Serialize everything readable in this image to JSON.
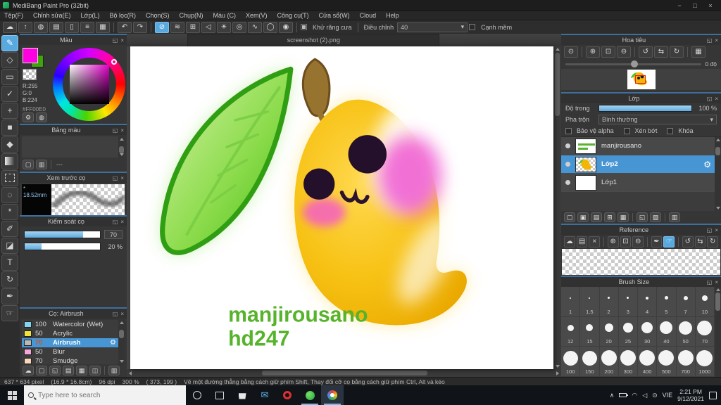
{
  "window": {
    "title": "MediBang Paint Pro (32bit)"
  },
  "icons": {
    "minimize": "−",
    "maximize": "□",
    "close": "×",
    "popout": "◱",
    "panel_close": "×",
    "cloud": "☁",
    "publish": "↑",
    "comment": "◍",
    "chat": "▤",
    "document": "▯",
    "config": "≡",
    "material": "▦",
    "undo": "↶",
    "redo": "↷",
    "snap_off": "⊘",
    "snap_parallel": "≋",
    "snap_cross": "⊞",
    "snap_vanish": "◁",
    "snap_radial": "☀",
    "snap_concentric": "◎",
    "snap_curve": "∿",
    "snap_ellipse": "◯",
    "snap_rings": "◉",
    "dropdown_arrow": "▾",
    "tool_brush": "✎",
    "tool_eraser": "◇",
    "tool_marquee": "▭",
    "tool_select_pen": "✓",
    "tool_move": "+",
    "tool_shape": "■",
    "tool_bucket": "◆",
    "tool_lasso": "◌",
    "tool_wand": "*",
    "tool_draft_pen": "✐",
    "tool_select_eraser": "◪",
    "tool_text": "T",
    "tool_transform": "↻",
    "tool_eraser2": "▱",
    "tool_eyedropper": "✒",
    "tool_hand": "☞",
    "new_item": "▢",
    "trash": "▥",
    "palette_color": "⚙",
    "palette_add": "◍",
    "zoom_actual": "⊙",
    "zoom_in": "⊕",
    "zoom_fit": "⊡",
    "zoom_out": "⊖",
    "rotate_left": "↺",
    "flip": "⇆",
    "rotate_right": "↻",
    "material_nav": "▦",
    "gear": "⚙",
    "layer_new": "▢",
    "layer_dup": "▣",
    "layer_conv": "▤",
    "layer_add_set": "⊞",
    "layer_folder": "▦",
    "layer_merge": "◱",
    "layer_special": "▧",
    "brush_cloud": "☁",
    "brush_new": "▢",
    "brush_new2": "◱",
    "brush_edit": "▤",
    "brush_folder": "▦",
    "brush_dup": "◫",
    "ref_folder": "▤",
    "ref_close": "×",
    "mail": "✉",
    "tray_chevron": "∧",
    "tray_wifi": "◠",
    "tray_speaker": "◁",
    "tray_pen": "⊙"
  },
  "menu": {
    "items": [
      "Tệp(F)",
      "Chỉnh sửa(E)",
      "Lớp(L)",
      "Bộ lọc(R)",
      "Chọn(S)",
      "Chụp(N)",
      "Màu (C)",
      "Xem(V)",
      "Công cụ(T)",
      "Cửa sổ(W)",
      "Cloud",
      "Help"
    ]
  },
  "toolbar": {
    "antialias_label": "Khử răng cưa",
    "correction_label": "Điều chỉnh",
    "correction_value": "40",
    "soft_edge_label": "Cạnh mềm"
  },
  "color_panel": {
    "title": "Màu",
    "r": "R:255",
    "g": "G:0",
    "b": "B:224",
    "hex": "#FF00E0",
    "foreground_color": "#FF00E0"
  },
  "palette_panel": {
    "title": "Bảng màu",
    "empty_label": "---"
  },
  "preview_panel": {
    "title": "Xem trước cọ",
    "brush_width": "18.52mm"
  },
  "control_panel": {
    "title": "Kiểm soát cọ",
    "size_value": "70",
    "opacity_value": "20 %"
  },
  "brush_panel": {
    "title": "Cọ: Airbrush",
    "items": [
      {
        "num": "100",
        "name": "Watercolor (Wet)",
        "color": "#7fd6ee"
      },
      {
        "num": "50",
        "name": "Acrylic",
        "color": "#f0e23c"
      },
      {
        "num": "70",
        "name": "Airbrush",
        "color": "#b8b8b8"
      },
      {
        "num": "50",
        "name": "Blur",
        "color": "#f8a8d8"
      },
      {
        "num": "70",
        "name": "Smudge",
        "color": "#f8d8b8"
      }
    ]
  },
  "canvas": {
    "tab": "screenshot (2).png",
    "signature_line1": "manjirousano",
    "signature_line2": "hd247"
  },
  "navigator": {
    "title": "Hoa tiêu",
    "angle": "0 độ"
  },
  "layers": {
    "title": "Lớp",
    "opacity_label": "Độ trong",
    "opacity_value": "100 %",
    "blend_label": "Pha trộn",
    "blend_value": "Bình thường",
    "protect_alpha_label": "Bảo vệ alpha",
    "clipping_label": "Xén bớt",
    "lock_label": "Khóa",
    "items": [
      {
        "name": "manjirousano"
      },
      {
        "name": "Lớp2"
      },
      {
        "name": "Lớp1"
      }
    ]
  },
  "reference": {
    "title": "Reference"
  },
  "brush_size": {
    "title": "Brush Size",
    "sizes": [
      "1",
      "1.5",
      "2",
      "3",
      "4",
      "5",
      "7",
      "10",
      "12",
      "15",
      "20",
      "25",
      "30",
      "40",
      "50",
      "70",
      "100",
      "150",
      "200",
      "300",
      "400",
      "500",
      "700",
      "1000"
    ]
  },
  "status": {
    "pixels": "637 * 634 pixel",
    "cm": "(16.9 * 16.8cm)",
    "dpi": "96 dpi",
    "zoom": "300 %",
    "coords": "( 373, 199 )",
    "hint": "Vẽ một đường thẳng bằng cách giữ phím Shift, Thay đổi cỡ cọ bằng cách giữ phím Ctrl, Alt và kéo"
  },
  "taskbar": {
    "search_placeholder": "Type here to search",
    "tray_lang": "VIE",
    "time": "2:21 PM",
    "date": "9/12/2021"
  }
}
